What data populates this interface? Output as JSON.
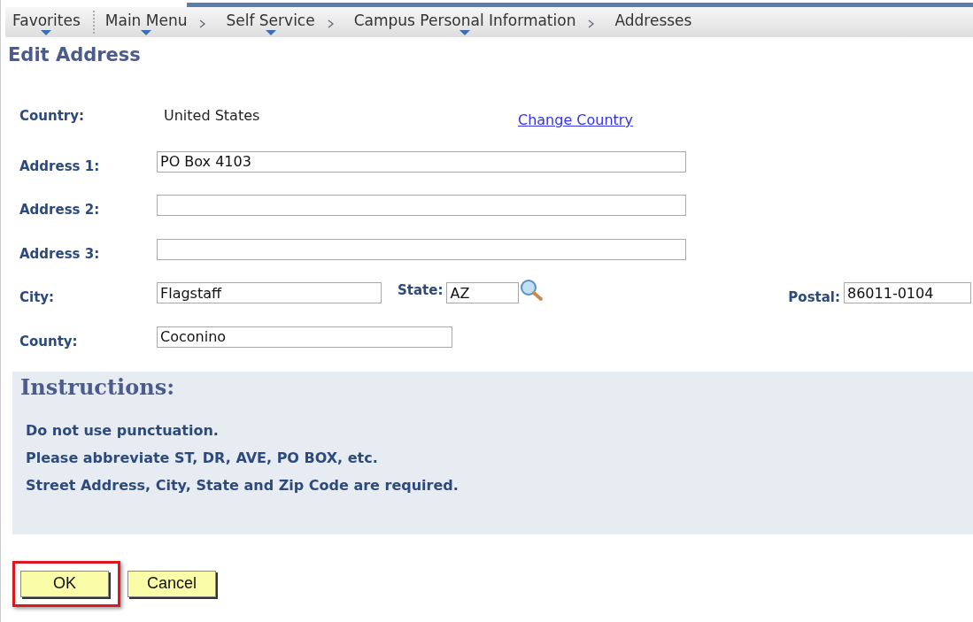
{
  "breadcrumbs": [
    {
      "label": "Favorites",
      "dropdown": true
    },
    {
      "label": "Main Menu",
      "dropdown": true
    },
    {
      "label": "Self Service",
      "dropdown": true
    },
    {
      "label": "Campus Personal Information",
      "dropdown": true
    },
    {
      "label": "Addresses",
      "dropdown": false
    }
  ],
  "title": "Edit Address",
  "country": {
    "label": "Country:",
    "value": "United States",
    "link": "Change Country"
  },
  "address_fields": [
    {
      "label": "Address 1:",
      "value": "PO Box 4103"
    },
    {
      "label": "Address 2:"
    },
    {
      "label": "Address 3:"
    }
  ],
  "city": {
    "label": "City:",
    "value": "Flagstaff"
  },
  "state": {
    "label": "State:",
    "value": "AZ"
  },
  "postal": {
    "label": "Postal:",
    "value": "86011-0104"
  },
  "county": {
    "label": "County:",
    "value": "Coconino"
  },
  "instructions": {
    "heading": "Instructions:",
    "lines": [
      "Do not use punctuation.",
      "Please abbreviate ST, DR, AVE, PO BOX, etc.",
      "Street Address, City, State and Zip Code are required."
    ]
  },
  "buttons": [
    {
      "label": "OK",
      "highlighted": true
    },
    {
      "label": "Cancel",
      "highlighted": false
    }
  ]
}
